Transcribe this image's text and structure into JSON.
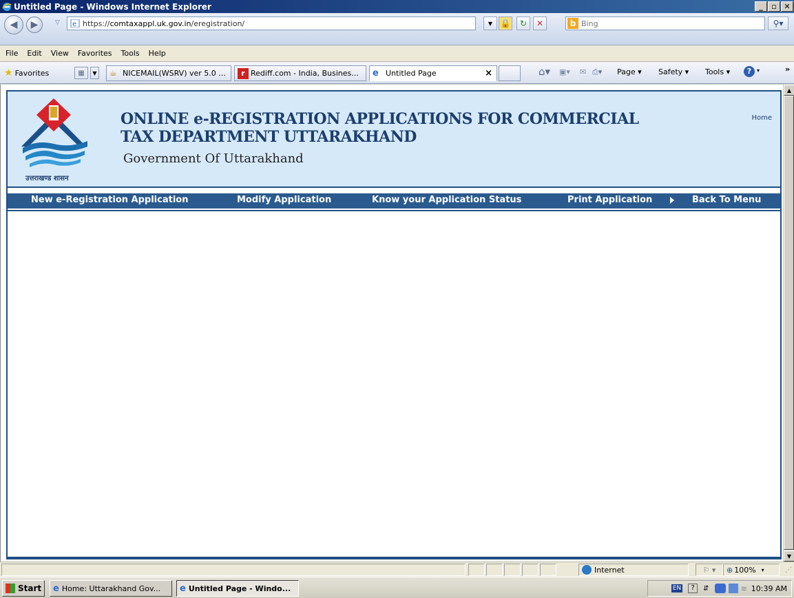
{
  "window": {
    "title": "Untitled Page - Windows Internet Explorer"
  },
  "address_bar": {
    "url_prefix": "https://",
    "url_domain": "comtaxappl.uk.gov.in",
    "url_path": "/eregistration/",
    "search_placeholder": "Bing"
  },
  "menu": [
    "File",
    "Edit",
    "View",
    "Favorites",
    "Tools",
    "Help"
  ],
  "favorites_bar": {
    "favorites_label": "Favorites",
    "tabs": [
      {
        "label": "NICEMAIL(WSRV) ver 5.0 ..."
      },
      {
        "label": "Rediff.com - India, Busines..."
      },
      {
        "label": "Untitled Page",
        "active": true
      }
    ],
    "tab_close": "×",
    "commands": [
      "Page ▾",
      "Safety ▾",
      "Tools ▾"
    ],
    "overflow": "»"
  },
  "page": {
    "heading": "ONLINE e-REGISTRATION APPLICATIONS FOR COMMERCIAL TAX DEPARTMENT UTTARAKHAND",
    "subheading": "Government Of Uttarakhand",
    "home_link": "Home",
    "logo_caption": "उत्तराखण्ड शासन",
    "nav": [
      "New e-Registration Application",
      "Modify Application",
      "Know your Application Status",
      "Print Application",
      "Back To Menu"
    ]
  },
  "status_bar": {
    "zone": "Internet",
    "zoom": "100%"
  },
  "taskbar": {
    "start_label": "Start",
    "items": [
      {
        "label": "Home: Uttarakhand Gov..."
      },
      {
        "label": "Untitled Page - Windo...",
        "active": true
      }
    ],
    "language": "EN",
    "clock": "10:39 AM"
  },
  "colors": {
    "banner_bg": "#d6e9f8",
    "nav_bg": "#2a5a8e",
    "heading": "#1b3e6e"
  }
}
